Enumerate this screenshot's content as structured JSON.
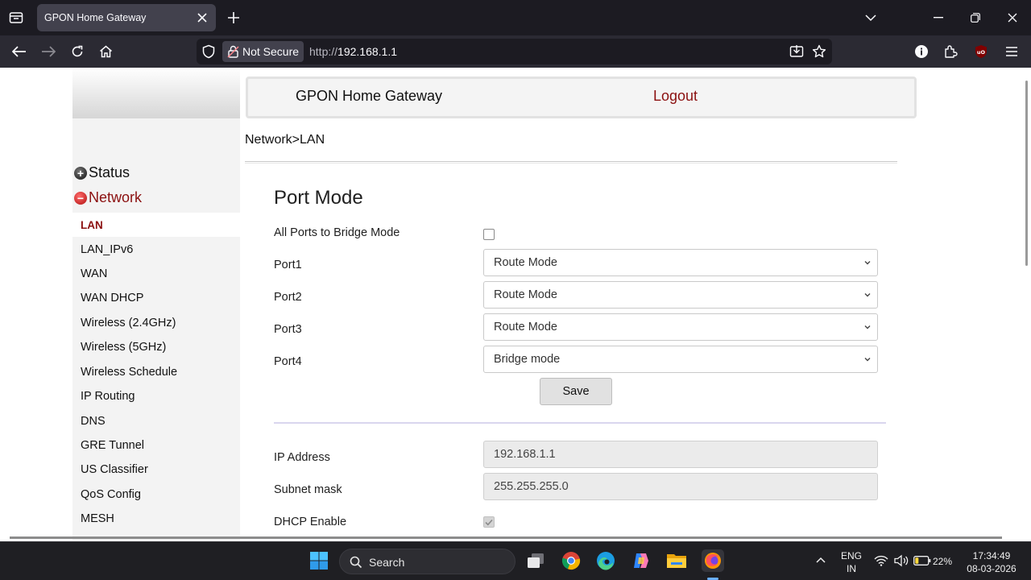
{
  "browser": {
    "tab_title": "GPON Home Gateway",
    "security_label": "Not Secure",
    "url_protocol": "http://",
    "url_host": "192.168.1.1"
  },
  "page": {
    "header_title": "GPON Home Gateway",
    "logout_label": "Logout",
    "breadcrumb": "Network>LAN",
    "sidebar": {
      "groups": [
        {
          "label": "Status",
          "expanded": false
        },
        {
          "label": "Network",
          "expanded": true
        }
      ],
      "items": [
        {
          "label": "LAN",
          "active": true
        },
        {
          "label": "LAN_IPv6"
        },
        {
          "label": "WAN"
        },
        {
          "label": "WAN DHCP"
        },
        {
          "label": "Wireless (2.4GHz)"
        },
        {
          "label": "Wireless (5GHz)"
        },
        {
          "label": "Wireless Schedule"
        },
        {
          "label": "IP Routing"
        },
        {
          "label": "DNS"
        },
        {
          "label": "GRE Tunnel"
        },
        {
          "label": "US Classifier"
        },
        {
          "label": "QoS Config"
        },
        {
          "label": "MESH"
        }
      ]
    },
    "port_mode": {
      "title": "Port Mode",
      "bridge_label": "All Ports to Bridge Mode",
      "bridge_checked": false,
      "ports": [
        {
          "label": "Port1",
          "value": "Route Mode"
        },
        {
          "label": "Port2",
          "value": "Route Mode"
        },
        {
          "label": "Port3",
          "value": "Route Mode"
        },
        {
          "label": "Port4",
          "value": "Bridge mode"
        }
      ],
      "save_label": "Save"
    },
    "lan_settings": {
      "ip_label": "IP Address",
      "ip_value": "192.168.1.1",
      "mask_label": "Subnet mask",
      "mask_value": "255.255.255.0",
      "dhcp_label": "DHCP Enable",
      "dhcp_checked": true
    }
  },
  "taskbar": {
    "search_label": "Search",
    "language_line1": "ENG",
    "language_line2": "IN",
    "battery_percent": "22%",
    "time": "17:34:49",
    "date": "08-03-2026"
  },
  "colors": {
    "accent_red": "#8b1010",
    "chrome_dark": "#1c1b22",
    "toolbar": "#2b2a33",
    "sidebar_bg": "#f3f3f3"
  },
  "icons": [
    "tab-list-icon",
    "close-icon",
    "plus-icon",
    "chevron-down-icon",
    "minimize-icon",
    "restore-icon",
    "back-icon",
    "forward-icon",
    "reload-icon",
    "home-icon",
    "shield-icon",
    "lock-icon",
    "save-to-device-icon",
    "star-icon",
    "info-icon",
    "extensions-icon",
    "ublock-icon",
    "menu-icon",
    "windows-start-icon",
    "search-icon",
    "task-view-icon",
    "chrome-icon",
    "edge-icon",
    "copilot-icon",
    "file-explorer-icon",
    "firefox-icon",
    "chevron-up-icon",
    "wifi-icon",
    "speaker-icon",
    "battery-icon"
  ]
}
